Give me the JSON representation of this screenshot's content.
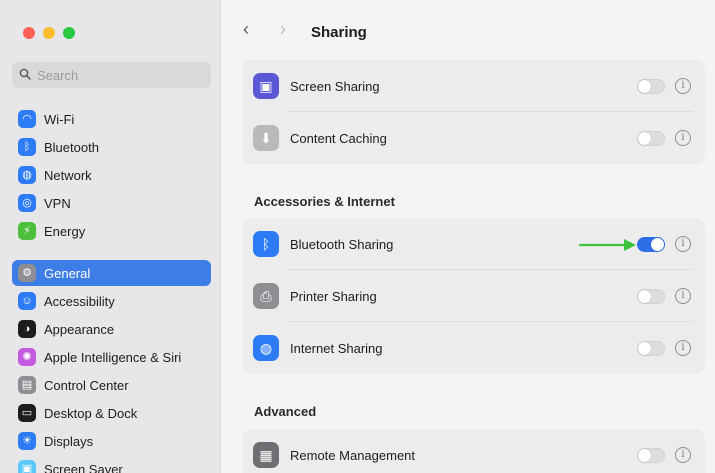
{
  "window": {
    "title": "Sharing"
  },
  "search": {
    "placeholder": "Search",
    "icon": "magnifying-glass-icon"
  },
  "sidebar": {
    "items": [
      {
        "label": "Wi-Fi",
        "icon": "wifi-icon",
        "color": "#2e7bf6",
        "glyph": "◠"
      },
      {
        "label": "Bluetooth",
        "icon": "bluetooth-icon",
        "color": "#2e7bf6",
        "glyph": "ᛒ"
      },
      {
        "label": "Network",
        "icon": "globe-icon",
        "color": "#2e7bf6",
        "glyph": "◍"
      },
      {
        "label": "VPN",
        "icon": "vpn-globe-icon",
        "color": "#2e7bf6",
        "glyph": "◎"
      },
      {
        "label": "Energy",
        "icon": "battery-bolt-icon",
        "color": "#4cbf3b",
        "glyph": "⚡"
      },
      {
        "label": "General",
        "icon": "gear-icon",
        "color": "#8e8e93",
        "glyph": "⚙",
        "active": true
      },
      {
        "label": "Accessibility",
        "icon": "accessibility-icon",
        "color": "#2e7bf6",
        "glyph": "☺"
      },
      {
        "label": "Appearance",
        "icon": "appearance-icon",
        "color": "#1d1d1f",
        "glyph": "◑"
      },
      {
        "label": "Apple Intelligence & Siri",
        "icon": "siri-icon",
        "color": "#c25be0",
        "glyph": "✺"
      },
      {
        "label": "Control Center",
        "icon": "control-center-icon",
        "color": "#8e8e93",
        "glyph": "▤"
      },
      {
        "label": "Desktop & Dock",
        "icon": "dock-icon",
        "color": "#1d1d1f",
        "glyph": "▭"
      },
      {
        "label": "Displays",
        "icon": "sun-icon",
        "color": "#2e7bf6",
        "glyph": "☀"
      },
      {
        "label": "Screen Saver",
        "icon": "screen-saver-icon",
        "color": "#5ac8fa",
        "glyph": "▣"
      }
    ]
  },
  "main": {
    "groups": [
      {
        "rows": [
          {
            "label": "Screen Sharing",
            "icon": "screen-sharing-icon",
            "color": "#5b58d6",
            "glyph": "▣",
            "enabled": false
          },
          {
            "label": "Content Caching",
            "icon": "content-caching-icon",
            "color": "#b9b9bc",
            "glyph": "⬇",
            "enabled": false
          }
        ]
      },
      {
        "header": "Accessories & Internet",
        "rows": [
          {
            "label": "Bluetooth Sharing",
            "icon": "bluetooth-sharing-icon",
            "color": "#2e7bf6",
            "glyph": "ᛒ",
            "enabled": true
          },
          {
            "label": "Printer Sharing",
            "icon": "printer-icon",
            "color": "#8e8e93",
            "glyph": "⎙",
            "enabled": false
          },
          {
            "label": "Internet Sharing",
            "icon": "internet-sharing-icon",
            "color": "#2e7bf6",
            "glyph": "◍",
            "enabled": false
          }
        ]
      },
      {
        "header": "Advanced",
        "rows": [
          {
            "label": "Remote Management",
            "icon": "remote-management-icon",
            "color": "#6f6f73",
            "glyph": "▦",
            "enabled": false
          }
        ]
      }
    ],
    "info_glyph": "i"
  },
  "annotation": {
    "arrow_color": "#3bc43b"
  }
}
